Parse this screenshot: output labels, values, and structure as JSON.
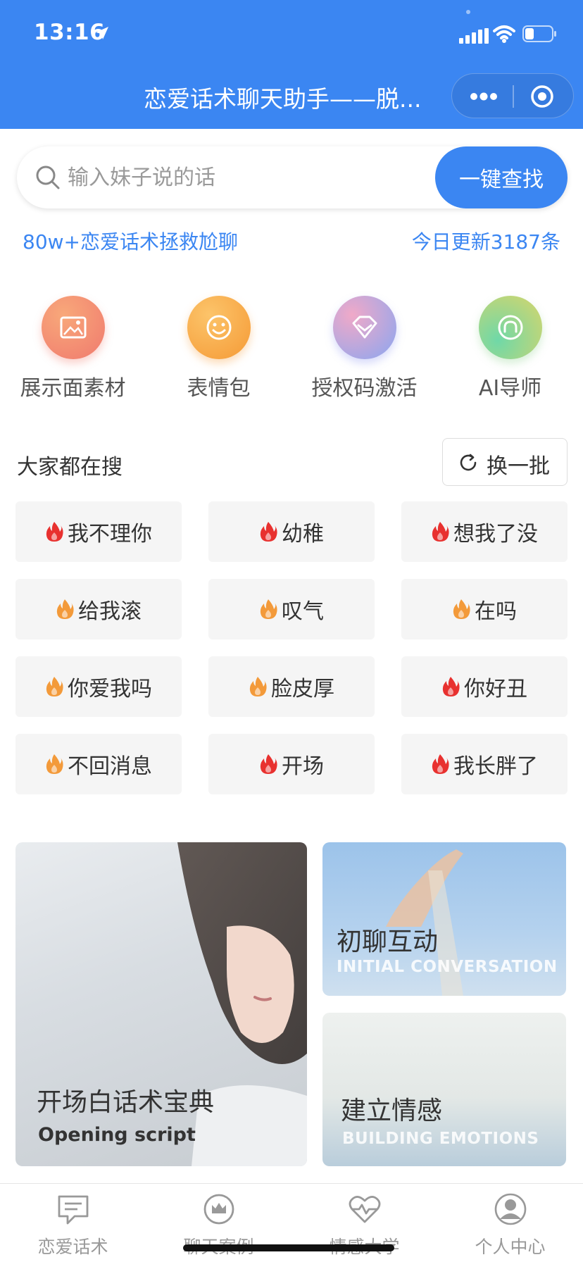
{
  "status_bar": {
    "time": "13:16"
  },
  "nav": {
    "title": "恋爱话术聊天助手——脱..."
  },
  "search": {
    "placeholder": "输入妹子说的话",
    "button_label": "一键查找"
  },
  "promo": {
    "left": "80w+恋爱话术拯救尬聊",
    "right": "今日更新3187条"
  },
  "quick_actions": [
    {
      "label": "展示面素材",
      "icon": "image-icon"
    },
    {
      "label": "表情包",
      "icon": "smiley-icon"
    },
    {
      "label": "授权码激活",
      "icon": "diamond-icon"
    },
    {
      "label": "AI导师",
      "icon": "headset-icon"
    }
  ],
  "hot_search": {
    "title": "大家都在搜",
    "refresh_label": "换一批",
    "tags": [
      {
        "label": "我不理你",
        "flame": "red"
      },
      {
        "label": "幼稚",
        "flame": "red"
      },
      {
        "label": "想我了没",
        "flame": "red"
      },
      {
        "label": "给我滚",
        "flame": "orange"
      },
      {
        "label": "叹气",
        "flame": "orange"
      },
      {
        "label": "在吗",
        "flame": "orange"
      },
      {
        "label": "你爱我吗",
        "flame": "orange"
      },
      {
        "label": "脸皮厚",
        "flame": "orange"
      },
      {
        "label": "你好丑",
        "flame": "red"
      },
      {
        "label": "不回消息",
        "flame": "orange"
      },
      {
        "label": "开场",
        "flame": "red"
      },
      {
        "label": "我长胖了",
        "flame": "red"
      }
    ]
  },
  "cards": {
    "opening": {
      "title": "开场白话术宝典",
      "subtitle": "Opening script"
    },
    "initial": {
      "title": "初聊互动",
      "subtitle": "INITIAL CONVERSATION"
    },
    "building": {
      "title": "建立情感",
      "subtitle": "BUILDING EMOTIONS"
    }
  },
  "tabs": [
    {
      "label": "恋爱话术",
      "icon": "chat-icon"
    },
    {
      "label": "聊天案例",
      "icon": "crown-icon"
    },
    {
      "label": "情感大学",
      "icon": "heart-pulse-icon"
    },
    {
      "label": "个人中心",
      "icon": "user-icon"
    }
  ],
  "colors": {
    "primary": "#3b86f2",
    "flame_red": "#e8312f",
    "flame_orange": "#f39a3a"
  }
}
